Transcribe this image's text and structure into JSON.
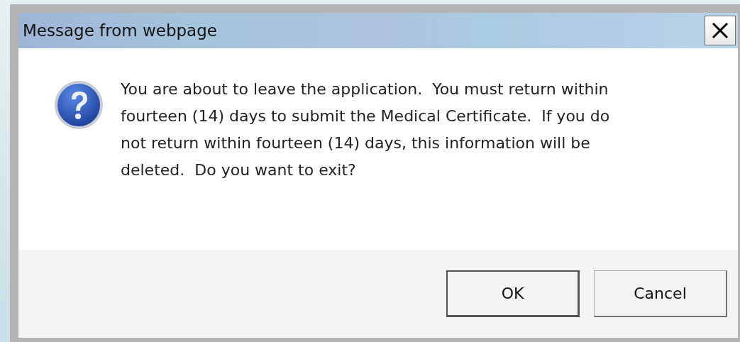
{
  "window": {
    "title": "Message from webpage"
  },
  "message_lines": [
    "You are about to leave the application.  You must return within",
    "fourteen (14) days to submit the Medical Certificate.  If you do",
    "not return within fourteen (14) days, this information will be",
    "deleted.  Do you want to exit?"
  ],
  "buttons": [
    {
      "label": "OK",
      "default": true
    },
    {
      "label": "Cancel",
      "default": false
    }
  ]
}
